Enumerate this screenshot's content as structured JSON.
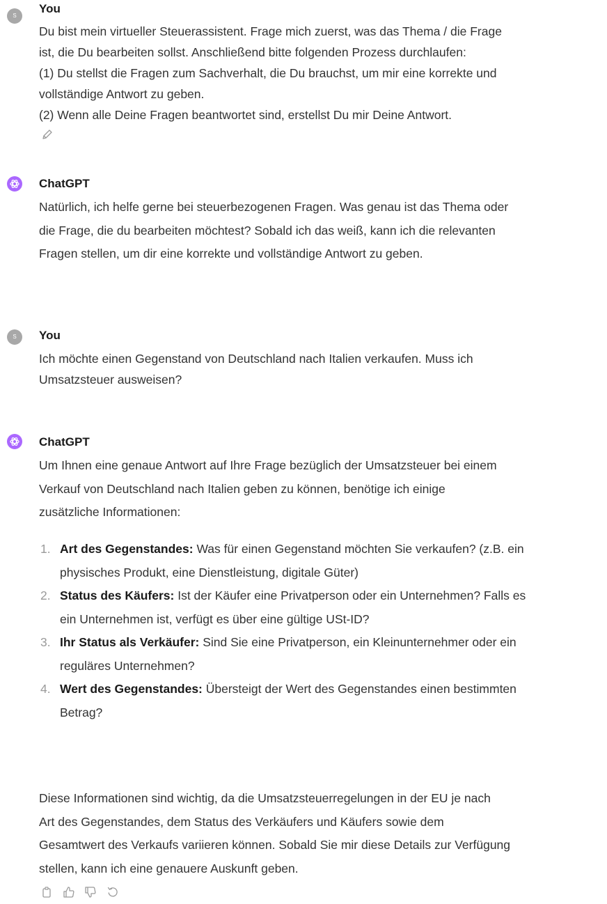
{
  "messages": [
    {
      "author": "You",
      "avatar_initial": "S",
      "lines": [
        "Du bist mein virtueller Steuerassistent. Frage mich zuerst, was das Thema / die Frage",
        "ist, die Du bearbeiten sollst. Anschließend bitte folgenden Prozess durchlaufen:",
        "(1) Du stellst die Fragen zum Sachverhalt, die Du brauchst, um mir eine korrekte und",
        "vollständige Antwort zu geben.",
        "(2) Wenn alle Deine Fragen beantwortet sind, erstellst Du mir Deine Antwort."
      ],
      "edit_icon": "pencil-icon"
    },
    {
      "author": "ChatGPT",
      "avatar_icon": "openai-logo-icon",
      "lines": [
        "Natürlich, ich helfe gerne bei steuerbezogenen Fragen. Was genau ist das Thema oder",
        "die Frage, die du bearbeiten möchtest? Sobald ich das weiß, kann ich die relevanten",
        "Fragen stellen, um dir eine korrekte und vollständige Antwort zu geben."
      ]
    },
    {
      "author": "You",
      "avatar_initial": "S",
      "lines": [
        "Ich möchte einen Gegenstand von Deutschland nach Italien verkaufen. Muss ich",
        "Umsatzsteuer ausweisen?"
      ]
    },
    {
      "author": "ChatGPT",
      "avatar_icon": "openai-logo-icon",
      "intro_lines": [
        "Um Ihnen eine genaue Antwort auf Ihre Frage bezüglich der Umsatzsteuer bei einem",
        "Verkauf von Deutschland nach Italien geben zu können, benötige ich einige",
        "zusätzliche Informationen:"
      ],
      "questions": [
        {
          "num": "1.",
          "label": "Art des Gegenstandes:",
          "lines": [
            " Was für einen Gegenstand möchten Sie verkaufen? (z.B. ein",
            "physisches Produkt, eine Dienstleistung, digitale Güter)"
          ]
        },
        {
          "num": "2.",
          "label": "Status des Käufers:",
          "lines": [
            " Ist der Käufer eine Privatperson oder ein Unternehmen? Falls es",
            "ein Unternehmen ist, verfügt es über eine gültige USt-ID?"
          ]
        },
        {
          "num": "3.",
          "label": "Ihr Status als Verkäufer:",
          "lines": [
            " Sind Sie eine Privatperson, ein Kleinunternehmer oder ein",
            "reguläres Unternehmen?"
          ]
        },
        {
          "num": "4.",
          "label": "Wert des Gegenstandes:",
          "lines": [
            " Übersteigt der Wert des Gegenstandes einen bestimmten",
            "Betrag?"
          ]
        }
      ],
      "outro_lines": [
        "Diese Informationen sind wichtig, da die Umsatzsteuerregelungen in der EU je nach",
        "Art des Gegenstandes, dem Status des Verkäufers und Käufers sowie dem",
        "Gesamtwert des Verkaufs variieren können. Sobald Sie mir diese Details zur Verfügung",
        "stellen, kann ich eine genauere Auskunft geben."
      ],
      "action_icons": [
        "copy-icon",
        "thumbs-up-icon",
        "thumbs-down-icon",
        "regenerate-icon"
      ]
    }
  ],
  "colors": {
    "user_avatar": "#a8a8a8",
    "gpt_avatar": "#ab68ff",
    "text": "#333333",
    "muted_icon": "#9a9a9a"
  }
}
